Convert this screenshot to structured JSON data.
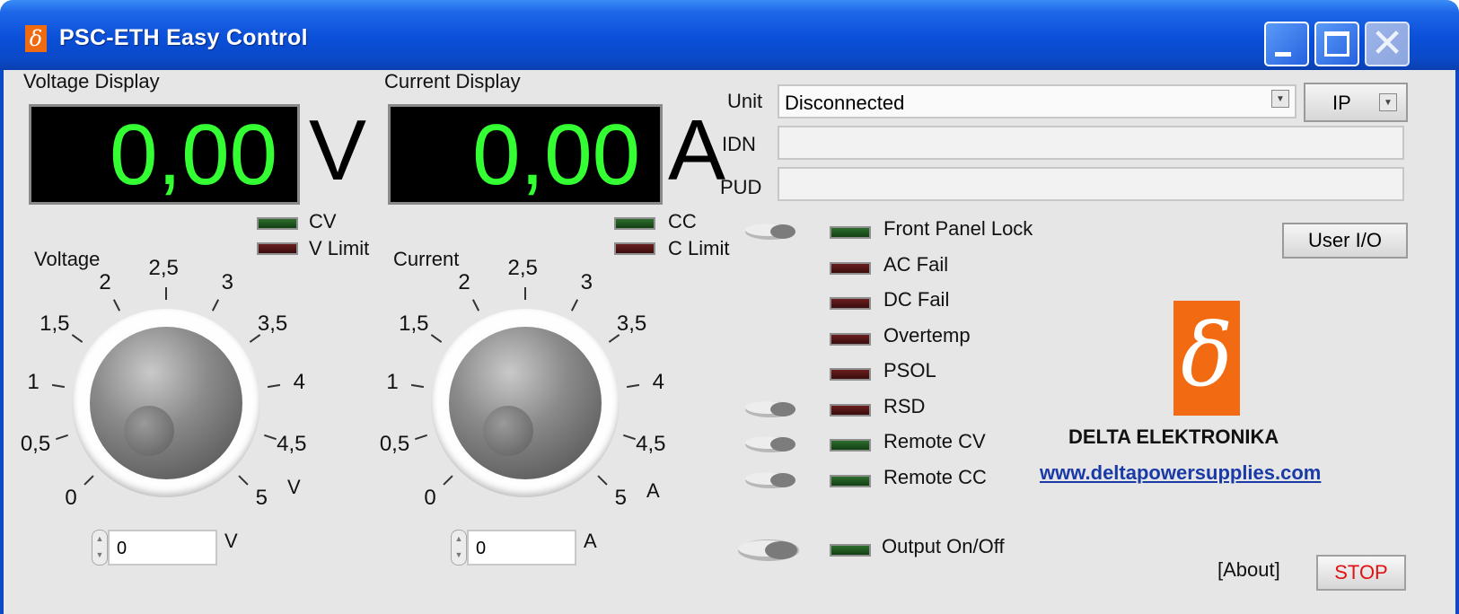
{
  "window": {
    "title": "PSC-ETH Easy Control",
    "title_icon": "δ",
    "close_glyph": "✕"
  },
  "voltage_display": {
    "label": "Voltage Display",
    "value": "0,00",
    "unit": "V"
  },
  "current_display": {
    "label": "Current Display",
    "value": "0,00",
    "unit": "A"
  },
  "voltage_indicators": [
    {
      "label": "CV",
      "state": "green"
    },
    {
      "label": "V Limit",
      "state": "red"
    }
  ],
  "current_indicators": [
    {
      "label": "CC",
      "state": "green"
    },
    {
      "label": "C Limit",
      "state": "red"
    }
  ],
  "voltage_knob": {
    "label": "Voltage",
    "unit": "V",
    "ticks": [
      "0",
      "0,5",
      "1",
      "1,5",
      "2",
      "2,5",
      "3",
      "3,5",
      "4",
      "4,5",
      "5"
    ],
    "value": 0,
    "input_value": "0",
    "input_unit": "V"
  },
  "current_knob": {
    "label": "Current",
    "unit": "A",
    "ticks": [
      "0",
      "0,5",
      "1",
      "1,5",
      "2",
      "2,5",
      "3",
      "3,5",
      "4",
      "4,5",
      "5"
    ],
    "value": 0,
    "input_value": "0",
    "input_unit": "A"
  },
  "unit_selector": {
    "label": "Unit",
    "value": "Disconnected",
    "mode": "IP",
    "idn_label": "IDN",
    "idn_value": "",
    "pud_label": "PUD",
    "pud_value": ""
  },
  "status_list": [
    {
      "label": "Front Panel Lock",
      "state": "green",
      "switch": true
    },
    {
      "label": "AC Fail",
      "state": "red",
      "switch": false
    },
    {
      "label": "DC Fail",
      "state": "red",
      "switch": false
    },
    {
      "label": "Overtemp",
      "state": "red",
      "switch": false
    },
    {
      "label": "PSOL",
      "state": "red",
      "switch": false
    },
    {
      "label": "RSD",
      "state": "red",
      "switch": true
    },
    {
      "label": "Remote CV",
      "state": "green",
      "switch": true
    },
    {
      "label": "Remote CC",
      "state": "green",
      "switch": true
    }
  ],
  "output": {
    "label": "Output On/Off",
    "state": "green"
  },
  "user_io_label": "User I/O",
  "brand": {
    "logo_glyph": "δ",
    "name": "DELTA ELEKTRONIKA",
    "url": "www.deltapowersupplies.com",
    "logo_color": "#f26a12"
  },
  "about_label": "[About]",
  "stop_label": "STOP",
  "colors": {
    "display_digits": "#33ff33",
    "led_green": "#2d6d2d",
    "led_red": "#5a1a1a",
    "title_blue": "#0a4fd8"
  }
}
